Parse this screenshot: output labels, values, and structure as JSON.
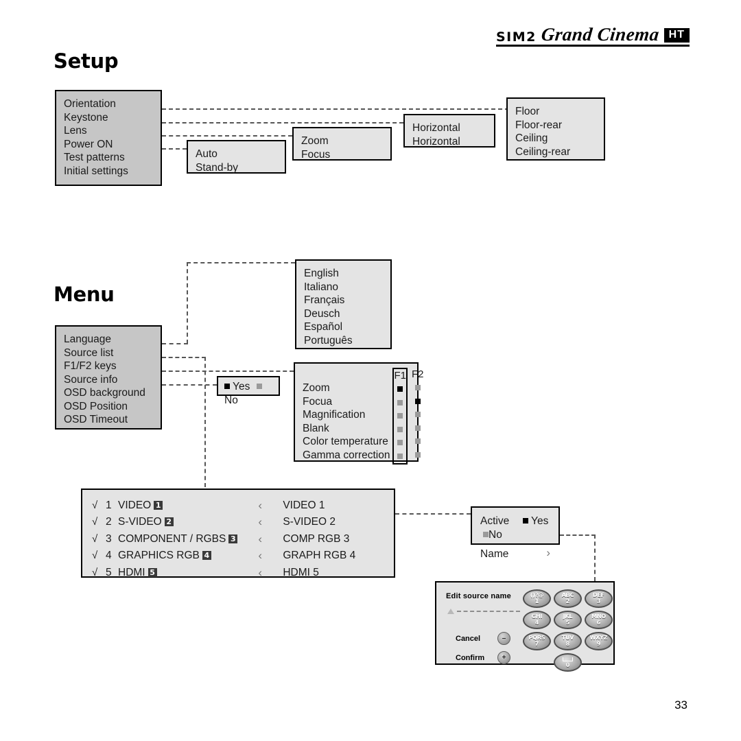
{
  "logo": {
    "brand": "SIM2",
    "product": "Grand Cinema",
    "badge": "HT"
  },
  "page_number": "33",
  "sections": {
    "setup": {
      "heading": "Setup",
      "menu": {
        "items": [
          "Orientation",
          "Keystone",
          "Lens",
          "Power ON",
          "Test patterns",
          "Initial settings"
        ]
      },
      "power_on": {
        "items": [
          "Auto",
          "Stand-by"
        ]
      },
      "lens": {
        "items": [
          "Zoom",
          "Focus"
        ]
      },
      "keystone": {
        "items": [
          "Horizontal",
          "Horizontal"
        ]
      },
      "orientation": {
        "items": [
          "Floor",
          "Floor-rear",
          "Ceiling",
          "Ceiling-rear"
        ]
      }
    },
    "menu": {
      "heading": "Menu",
      "menu": {
        "items": [
          "Language",
          "Source list",
          "F1/F2 keys",
          "Source info",
          "OSD background",
          "OSD Position",
          "OSD Timeout"
        ]
      },
      "language": {
        "items": [
          "English",
          "Italiano",
          "Français",
          "Deusch",
          "Español",
          "Português"
        ]
      },
      "source_info": {
        "options": [
          {
            "label": "Yes",
            "state": "on"
          },
          {
            "label": "No",
            "state": "off"
          }
        ]
      },
      "f1f2": {
        "columns": [
          "F1",
          "F2"
        ],
        "rows": [
          {
            "label": "Zoom",
            "f1": "on",
            "f2": "off"
          },
          {
            "label": "Focua",
            "f1": "off",
            "f2": "on"
          },
          {
            "label": "Magnification",
            "f1": "off",
            "f2": "off"
          },
          {
            "label": "Blank",
            "f1": "off",
            "f2": "off"
          },
          {
            "label": "Color temperature",
            "f1": "off",
            "f2": "off"
          },
          {
            "label": "Gamma correction",
            "f1": "off",
            "f2": "off"
          }
        ]
      },
      "source_list": {
        "check": "√",
        "chevron": "‹",
        "rows": [
          {
            "num": "1",
            "name": "VIDEO",
            "badge": "1",
            "alias": "VIDEO 1"
          },
          {
            "num": "2",
            "name": "S-VIDEO",
            "badge": "2",
            "alias": "S-VIDEO 2"
          },
          {
            "num": "3",
            "name": "COMPONENT / RGBS",
            "badge": "3",
            "alias": "COMP RGB 3"
          },
          {
            "num": "4",
            "name": "GRAPHICS RGB",
            "badge": "4",
            "alias": "GRAPH RGB 4"
          },
          {
            "num": "5",
            "name": "HDMI",
            "badge": "5",
            "alias": "HDMI 5"
          }
        ]
      },
      "source_detail": {
        "active_label": "Active",
        "active_options": [
          {
            "label": "Yes",
            "state": "on"
          },
          {
            "label": "No",
            "state": "off"
          }
        ],
        "name_label": "Name",
        "name_chevron": "›"
      },
      "edit_name": {
        "title": "Edit source name",
        "cancel_label": "Cancel",
        "cancel_glyph": "–",
        "confirm_label": "Confirm",
        "confirm_glyph": "+",
        "keys": [
          {
            "top": "()?@",
            "bottom": "1"
          },
          {
            "top": "ABC",
            "bottom": "2"
          },
          {
            "top": "DEF",
            "bottom": "3"
          },
          {
            "top": "GHI",
            "bottom": "4"
          },
          {
            "top": "JKL",
            "bottom": "5"
          },
          {
            "top": "MNO",
            "bottom": "6"
          },
          {
            "top": "PQRS",
            "bottom": "7"
          },
          {
            "top": "TUV",
            "bottom": "8"
          },
          {
            "top": "WXYZ",
            "bottom": "9"
          },
          {
            "top": "space",
            "bottom": "0"
          }
        ]
      }
    }
  }
}
